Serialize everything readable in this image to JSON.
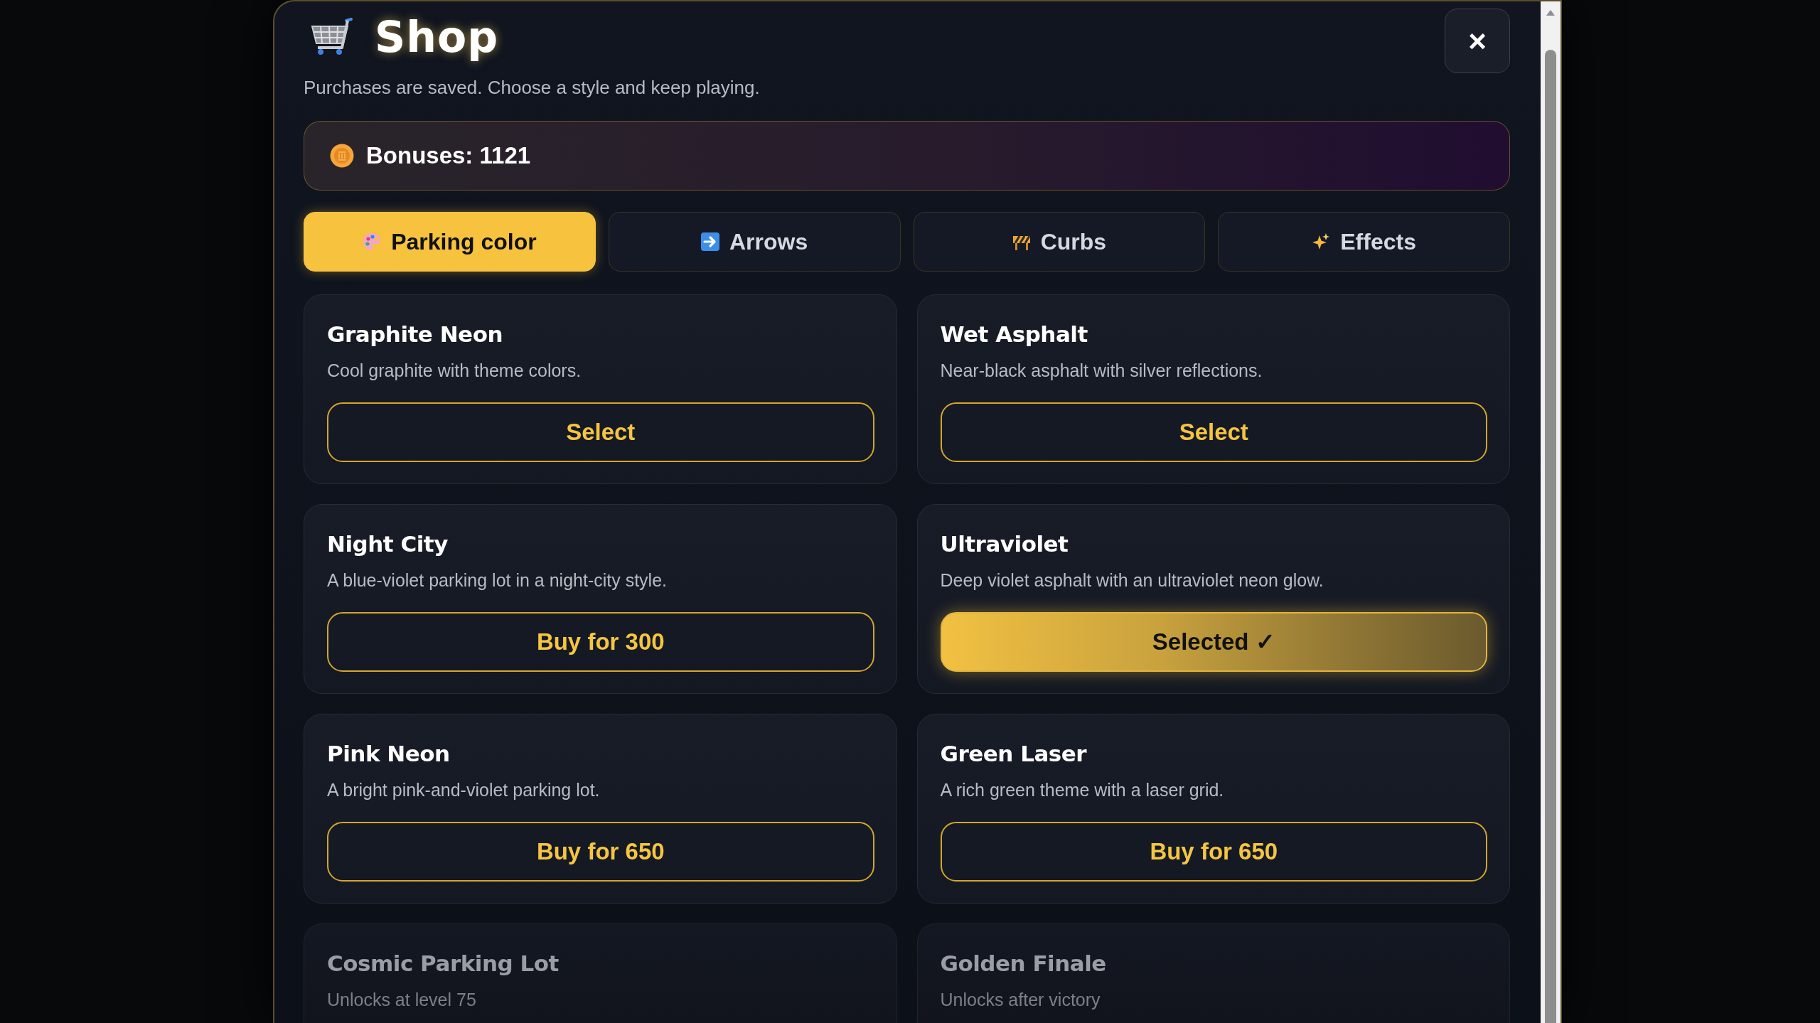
{
  "dialog": {
    "title": "Shop",
    "subtitle": "Purchases are saved. Choose a style and keep playing.",
    "close": "×"
  },
  "balance": {
    "label": "Bonuses: 1121"
  },
  "tabs": [
    {
      "label": "Parking color",
      "selected": true
    },
    {
      "label": "Arrows",
      "selected": false
    },
    {
      "label": "Curbs",
      "selected": false
    },
    {
      "label": "Effects",
      "selected": false
    }
  ],
  "items": [
    {
      "name": "Graphite Neon",
      "description": "Cool graphite with theme colors.",
      "button": "Select",
      "locked": false,
      "selected": false
    },
    {
      "name": "Wet Asphalt",
      "description": "Near-black asphalt with silver reflections.",
      "button": "Select",
      "locked": false,
      "selected": false
    },
    {
      "name": "Night City",
      "description": "A blue-violet parking lot in a night-city style.",
      "button": "Buy for 300",
      "locked": false,
      "selected": false
    },
    {
      "name": "Ultraviolet",
      "description": "Deep violet asphalt with an ultraviolet neon glow.",
      "button": "Selected ✓",
      "locked": false,
      "selected": true
    },
    {
      "name": "Pink Neon",
      "description": "A bright pink-and-violet parking lot.",
      "button": "Buy for 650",
      "locked": false,
      "selected": false
    },
    {
      "name": "Green Laser",
      "description": "A rich green theme with a laser grid.",
      "button": "Buy for 650",
      "locked": false,
      "selected": false
    },
    {
      "name": "Cosmic Parking Lot",
      "description": "Unlocks at level 75",
      "locked": true,
      "selected": false
    },
    {
      "name": "Golden Finale",
      "description": "Unlocks after victory",
      "locked": true,
      "selected": false
    }
  ]
}
